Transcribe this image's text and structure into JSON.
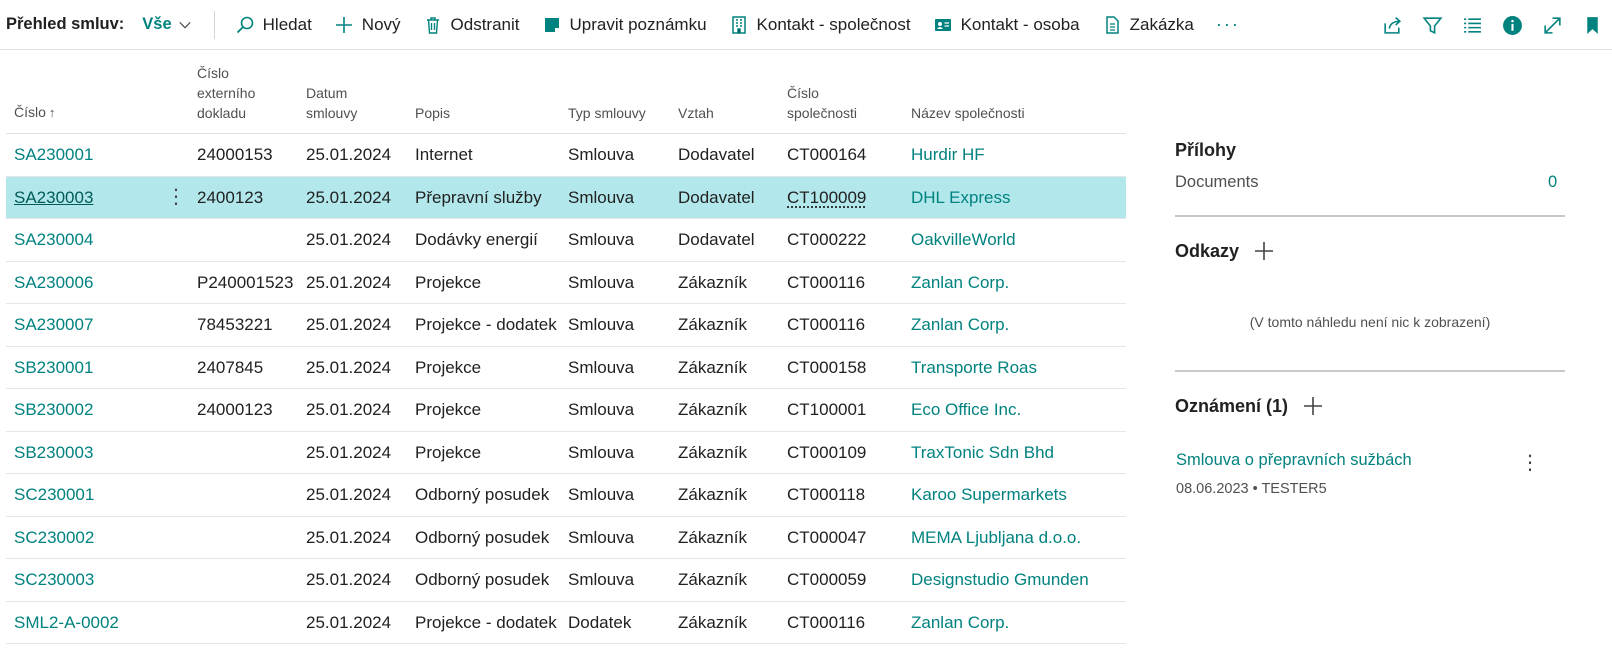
{
  "toolbar": {
    "page_title": "Přehled smluv:",
    "view_value": "Vše",
    "actions": [
      {
        "label": "Hledat",
        "icon": "search-icon"
      },
      {
        "label": "Nový",
        "icon": "plus-icon"
      },
      {
        "label": "Odstranit",
        "icon": "trash-icon"
      },
      {
        "label": "Upravit poznámku",
        "icon": "note-edit-icon"
      },
      {
        "label": "Kontakt - společnost",
        "icon": "building-icon"
      },
      {
        "label": "Kontakt - osoba",
        "icon": "contact-card-icon"
      },
      {
        "label": "Zakázka",
        "icon": "document-icon"
      }
    ],
    "more_label": "···",
    "right_icons": [
      "share-icon",
      "filter-icon",
      "list-view-icon",
      "info-icon",
      "expand-icon",
      "bookmark-icon"
    ]
  },
  "table": {
    "columns": {
      "num": "Číslo",
      "ext": "Číslo externího dokladu",
      "date": "Datum smlouvy",
      "desc": "Popis",
      "type": "Typ smlouvy",
      "rel": "Vztah",
      "comp": "Číslo společnosti",
      "name": "Název společnosti"
    },
    "sort_arrow": "↑",
    "row_menu": "⋮",
    "rows": [
      {
        "num": "SA230001",
        "ext": "24000153",
        "date": "25.01.2024",
        "desc": "Internet",
        "type": "Smlouva",
        "rel": "Dodavatel",
        "comp": "CT000164",
        "name": "Hurdir HF"
      },
      {
        "num": "SA230003",
        "ext": "2400123",
        "date": "25.01.2024",
        "desc": "Přepravní služby",
        "type": "Smlouva",
        "rel": "Dodavatel",
        "comp": "CT100009",
        "name": "DHL Express"
      },
      {
        "num": "SA230004",
        "ext": "",
        "date": "25.01.2024",
        "desc": "Dodávky energií",
        "type": "Smlouva",
        "rel": "Dodavatel",
        "comp": "CT000222",
        "name": "OakvilleWorld"
      },
      {
        "num": "SA230006",
        "ext": "P240001523",
        "date": "25.01.2024",
        "desc": "Projekce",
        "type": "Smlouva",
        "rel": "Zákazník",
        "comp": "CT000116",
        "name": "Zanlan Corp."
      },
      {
        "num": "SA230007",
        "ext": "78453221",
        "date": "25.01.2024",
        "desc": "Projekce - dodatek",
        "type": "Smlouva",
        "rel": "Zákazník",
        "comp": "CT000116",
        "name": "Zanlan Corp."
      },
      {
        "num": "SB230001",
        "ext": "2407845",
        "date": "25.01.2024",
        "desc": "Projekce",
        "type": "Smlouva",
        "rel": "Zákazník",
        "comp": "CT000158",
        "name": "Transporte Roas"
      },
      {
        "num": "SB230002",
        "ext": "24000123",
        "date": "25.01.2024",
        "desc": "Projekce",
        "type": "Smlouva",
        "rel": "Zákazník",
        "comp": "CT100001",
        "name": "Eco Office Inc."
      },
      {
        "num": "SB230003",
        "ext": "",
        "date": "25.01.2024",
        "desc": "Projekce",
        "type": "Smlouva",
        "rel": "Zákazník",
        "comp": "CT000109",
        "name": "TraxTonic Sdn Bhd"
      },
      {
        "num": "SC230001",
        "ext": "",
        "date": "25.01.2024",
        "desc": "Odborný posudek",
        "type": "Smlouva",
        "rel": "Zákazník",
        "comp": "CT000118",
        "name": "Karoo Supermarkets"
      },
      {
        "num": "SC230002",
        "ext": "",
        "date": "25.01.2024",
        "desc": "Odborný posudek",
        "type": "Smlouva",
        "rel": "Zákazník",
        "comp": "CT000047",
        "name": "MEMA Ljubljana d.o.o."
      },
      {
        "num": "SC230003",
        "ext": "",
        "date": "25.01.2024",
        "desc": "Odborný posudek",
        "type": "Smlouva",
        "rel": "Zákazník",
        "comp": "CT000059",
        "name": "Designstudio Gmunden"
      },
      {
        "num": "SML2-A-0002",
        "ext": "",
        "date": "25.01.2024",
        "desc": "Projekce - dodatek",
        "type": "Dodatek",
        "rel": "Zákazník",
        "comp": "CT000116",
        "name": "Zanlan Corp."
      }
    ]
  },
  "factbox": {
    "attachments_title": "Přílohy",
    "documents_label": "Documents",
    "documents_count": "0",
    "links_title": "Odkazy",
    "links_empty": "(V tomto náhledu není nic k zobrazení)",
    "notes_title": "Oznámení (1)",
    "note": {
      "title": "Smlouva o přepravních sužbách",
      "meta": "08.06.2023 • TESTER5",
      "menu": "⋮"
    }
  },
  "colors": {
    "accent": "#00827f",
    "selected_row": "#b2e8eb"
  }
}
